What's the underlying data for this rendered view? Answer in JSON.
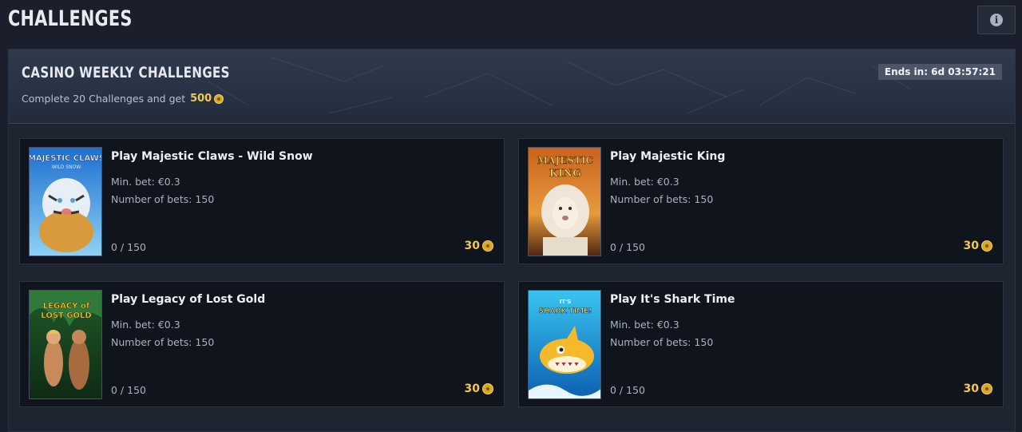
{
  "page": {
    "title": "CHALLENGES"
  },
  "info_button": {
    "icon": "info-icon"
  },
  "banner": {
    "title": "CASINO WEEKLY CHALLENGES",
    "subtitle": "Complete 20 Challenges and get",
    "reward_amount": "500",
    "ends_label": "Ends in: 6d 03:57:21"
  },
  "challenges": [
    {
      "title": "Play Majestic Claws - Wild Snow",
      "min_bet": "Min. bet: €0.3",
      "num_bets": "Number of bets: 150",
      "progress": "0 / 150",
      "reward": "30",
      "art_text": "MAJESTIC CLAWS",
      "art_sub": "WILD SNOW"
    },
    {
      "title": "Play Majestic King",
      "min_bet": "Min. bet: €0.3",
      "num_bets": "Number of bets: 150",
      "progress": "0 / 150",
      "reward": "30",
      "art_text": "MAJESTIC",
      "art_sub": "KING"
    },
    {
      "title": "Play Legacy of Lost Gold",
      "min_bet": "Min. bet: €0.3",
      "num_bets": "Number of bets: 150",
      "progress": "0 / 150",
      "reward": "30",
      "art_text": "LEGACY of",
      "art_sub": "LOST GOLD"
    },
    {
      "title": "Play It's Shark Time",
      "min_bet": "Min. bet: €0.3",
      "num_bets": "Number of bets: 150",
      "progress": "0 / 150",
      "reward": "30",
      "art_text": "IT'S",
      "art_sub": "SHARK TIME!"
    }
  ]
}
